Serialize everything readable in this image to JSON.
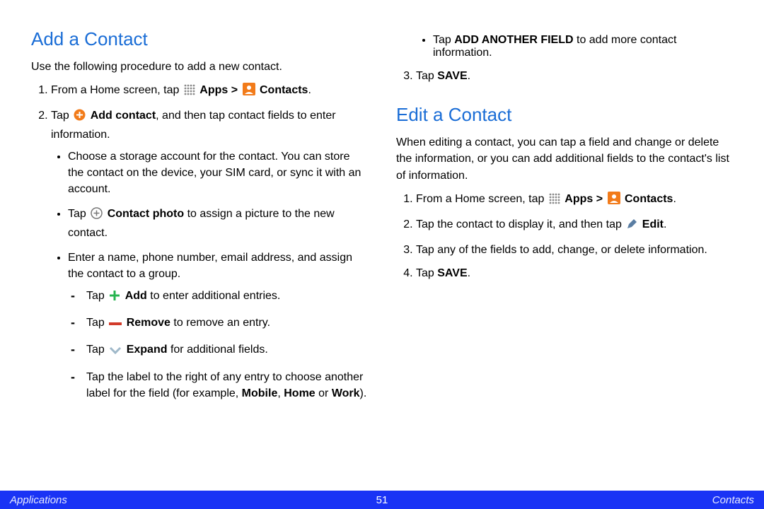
{
  "add": {
    "heading": "Add a Contact",
    "intro": "Use the following procedure to add a new contact.",
    "step1_a": "From a Home screen, tap ",
    "apps": "Apps",
    "gt": " > ",
    "contacts": "Contacts",
    "period": ".",
    "step2_a": "Tap ",
    "step2_b": "Add contact",
    "step2_c": ", and then tap contact fields to enter information.",
    "b1": "Choose a storage account for the contact. You can store the contact on the device, your SIM card, or sync it with an account.",
    "b2_a": "Tap ",
    "b2_b": "Contact photo",
    "b2_c": " to assign a picture to the new contact.",
    "b3": "Enter a name, phone number, email address, and assign the contact to a group.",
    "d1_a": "Tap ",
    "d1_b": "Add",
    "d1_c": " to enter additional entries.",
    "d2_a": "Tap ",
    "d2_b": "Remove",
    "d2_c": " to remove an entry.",
    "d3_a": "Tap ",
    "d3_b": "Expand",
    "d3_c": " for additional fields.",
    "d4_a": "Tap the label to the right of any entry to choose another label for the field (for example, ",
    "d4_b": "Mobile",
    "d4_c": ", ",
    "d4_d": "Home",
    "d4_e": " or ",
    "d4_f": "Work",
    "d4_g": ").",
    "b4_a": "Tap ",
    "b4_b": "ADD ANOTHER FIELD",
    "b4_c": " to add more contact information.",
    "step3_a": "Tap ",
    "step3_b": "SAVE",
    "step3_c": "."
  },
  "edit": {
    "heading": "Edit a Contact",
    "intro": "When editing a contact, you can tap a field and change or delete the information, or you can add additional fields to the contact's list of information.",
    "s1_a": "From a Home screen, tap ",
    "s2_a": "Tap the contact to display it, and then tap ",
    "s2_b": "Edit",
    "s2_c": ".",
    "s3": "Tap any of the fields to add, change, or delete information.",
    "s4_a": "Tap ",
    "s4_b": "SAVE",
    "s4_c": "."
  },
  "footer": {
    "left": "Applications",
    "center": "51",
    "right": "Contacts"
  }
}
